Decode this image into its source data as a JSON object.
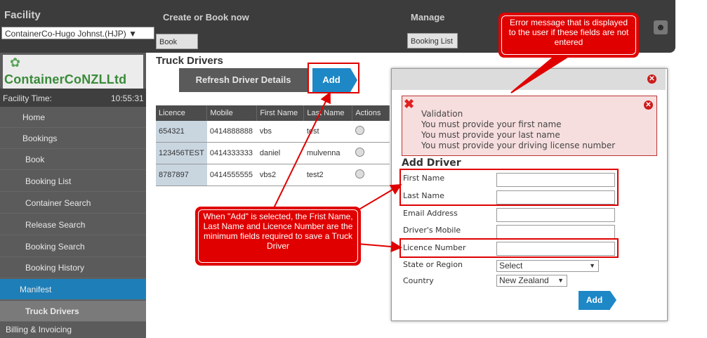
{
  "header": {
    "facility_label": "Facility",
    "facility_value": "ContainerCo-Hugo Johnst.(HJP) ▼",
    "create_label": "Create or Book now",
    "book_button": "Book",
    "manage_label": "Manage",
    "booking_list_button": "Booking List"
  },
  "sidebar": {
    "logo_text": "ContainerCoNZLLtd",
    "facility_time_label": "Facility Time:",
    "facility_time_value": "10:55:31",
    "items": [
      {
        "label": "Home"
      },
      {
        "label": "Bookings"
      },
      {
        "label": "Book"
      },
      {
        "label": "Booking List"
      },
      {
        "label": "Container Search"
      },
      {
        "label": "Release Search"
      },
      {
        "label": "Booking Search"
      },
      {
        "label": "Booking History"
      },
      {
        "label": "Manifest"
      },
      {
        "label": "Truck Drivers"
      },
      {
        "label": "Billing & Invoicing"
      }
    ],
    "colors": {
      "active_bg": "#1e7fb8",
      "selected_bg": "#7a7a7a"
    }
  },
  "main": {
    "title": "Truck Drivers",
    "refresh_button": "Refresh Driver Details",
    "add_button": "Add",
    "table": {
      "headers": [
        "Licence",
        "Mobile",
        "First Name",
        "Last Name",
        "Actions"
      ],
      "rows": [
        [
          "654321",
          "0414888888",
          "vbs",
          "test"
        ],
        [
          "123456TEST",
          "0414333333",
          "daniel",
          "mulvenna"
        ],
        [
          "8787897",
          "0414555555",
          "vbs2",
          "test2"
        ]
      ]
    }
  },
  "modal": {
    "validation": {
      "title": "Validation",
      "messages": [
        "You must provide your first name",
        "You must provide your last name",
        "You must provide your driving license number"
      ]
    },
    "form_title": "Add Driver",
    "fields": {
      "first_name": "First Name",
      "last_name": "Last Name",
      "email": "Email Address",
      "mobile": "Driver's Mobile",
      "licence": "Licence Number",
      "state": "State or Region",
      "country": "Country"
    },
    "state_value": "Select",
    "country_value": "New Zealand",
    "add_button": "Add"
  },
  "callouts": {
    "error_note": "Error message that is displayed to the user if these fields are not entered",
    "add_note": "When \"Add\" is selected, the Frist Name, Last Name and Licence Number are the minimum fields required to save a Truck Driver"
  },
  "colors": {
    "accent": "#1e88c7",
    "annotation": "#e00000",
    "error_bg": "#f7dede"
  }
}
